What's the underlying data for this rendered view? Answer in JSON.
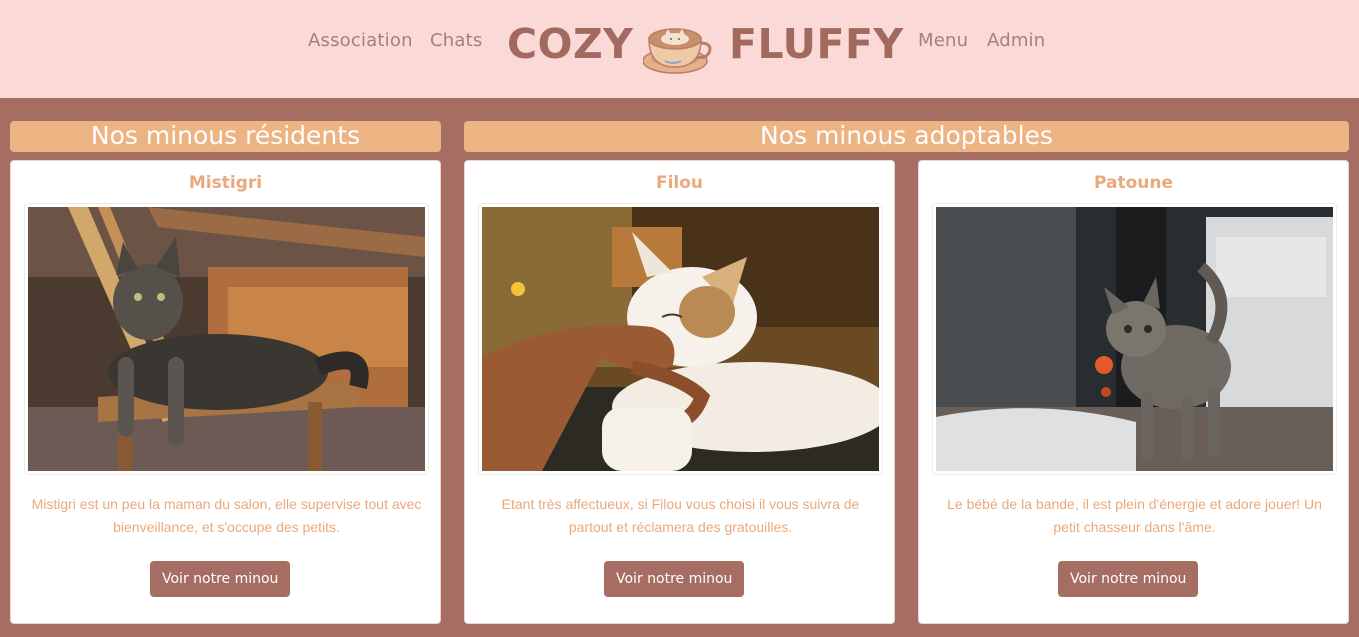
{
  "header": {
    "nav_left": [
      "Association",
      "Chats"
    ],
    "brand_left": "COZY",
    "brand_right": "FLUFFY",
    "nav_right": [
      "Menu",
      "Admin"
    ]
  },
  "sections": {
    "residents_title": "Nos minous résidents",
    "adoptables_title": "Nos minous adoptables"
  },
  "cats": [
    {
      "name": "Mistigri",
      "description": "Mistigri est un peu la maman du salon, elle supervise tout avec bienveillance, et s'occupe des petits.",
      "button": "Voir notre minou"
    },
    {
      "name": "Filou",
      "description": "Etant très affectueux, si Filou vous choisi il vous suivra de partout et réclamera des gratouilles.",
      "button": "Voir notre minou"
    },
    {
      "name": "Patoune",
      "description": "Le bébé de la bande, il est plein d'énergie et adore jouer! Un petit chasseur dans l'âme.",
      "button": "Voir notre minou"
    }
  ],
  "colors": {
    "header_bg": "#fbd9d6",
    "page_bg": "#a66d62",
    "accent": "#ecb383",
    "text_accent": "#e9a97b"
  }
}
